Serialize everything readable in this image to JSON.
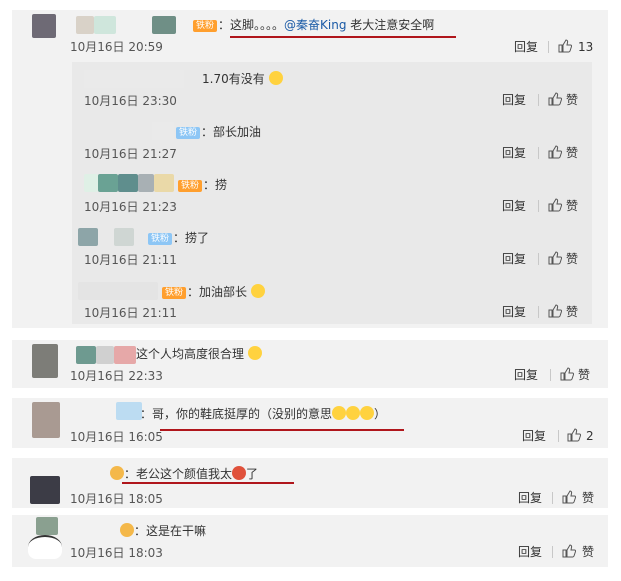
{
  "comments": [
    {
      "text_prefix": "：这脚。。。。",
      "mention": "@秦奋King",
      "text_suffix": " 老大注意安全啊",
      "badge": "铁粉",
      "time": "10月16日 20:59",
      "reply": "回复",
      "likes": "13",
      "replies": [
        {
          "text": "1.70有没有",
          "badge": "",
          "time": "10月16日 23:30",
          "reply": "回复",
          "likes": "赞"
        },
        {
          "text": "部长加油",
          "badge": "铁粉",
          "time": "10月16日 21:27",
          "reply": "回复",
          "likes": "赞"
        },
        {
          "text": "：捞",
          "badge": "铁粉",
          "time": "10月16日 21:23",
          "reply": "回复",
          "likes": "赞"
        },
        {
          "text": "：捞了",
          "badge": "铁粉",
          "time": "10月16日 21:11",
          "reply": "回复",
          "likes": "赞"
        },
        {
          "text": "：加油部长",
          "badge": "铁粉",
          "time": "10月16日 21:11",
          "reply": "回复",
          "likes": "赞"
        }
      ]
    },
    {
      "text": "这个人均高度很合理",
      "time": "10月16日 22:33",
      "reply": "回复",
      "likes": "赞"
    },
    {
      "text": "：哥，你的鞋底挺厚的（没别的意思",
      "text_end": "）",
      "time": "10月16日 16:05",
      "reply": "回复",
      "likes": "2"
    },
    {
      "text": "：老公这个颜值我太",
      "text_end": "了",
      "time": "10月16日 18:05",
      "reply": "回复",
      "likes": "赞"
    },
    {
      "text": "：这是在干嘛",
      "time": "10月16日 18:03",
      "reply": "回复",
      "likes": "赞"
    }
  ],
  "colors": {
    "underline": "#b0161c",
    "mention": "#1a5aa6",
    "badge_orange": "#ff9f2e",
    "badge_blue": "#8dc6f5"
  }
}
